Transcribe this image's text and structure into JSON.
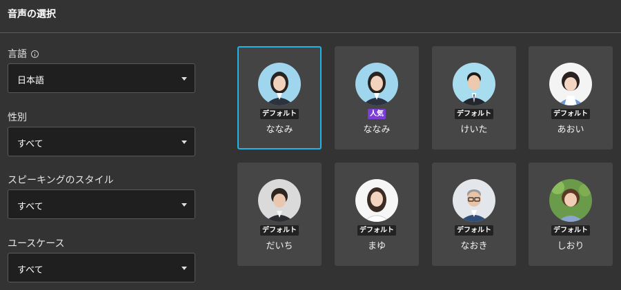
{
  "dialog": {
    "title": "音声の選択"
  },
  "filters": {
    "language": {
      "label": "言語",
      "value": "日本語"
    },
    "gender": {
      "label": "性別",
      "value": "すべて"
    },
    "style": {
      "label": "スピーキングのスタイル",
      "value": "すべて"
    },
    "usecase": {
      "label": "ユースケース",
      "value": "すべて"
    }
  },
  "voices": [
    {
      "name": "ななみ",
      "badge": "デフォルト",
      "selected": true
    },
    {
      "name": "ななみ",
      "badge": "人気"
    },
    {
      "name": "けいた",
      "badge": "デフォルト"
    },
    {
      "name": "あおい",
      "badge": "デフォルト"
    },
    {
      "name": "だいち",
      "badge": "デフォルト"
    },
    {
      "name": "まゆ",
      "badge": "デフォルト"
    },
    {
      "name": "なおき",
      "badge": "デフォルト"
    },
    {
      "name": "しおり",
      "badge": "デフォルト"
    }
  ],
  "colors": {
    "selection_border": "#1eb6e6",
    "popular_badge": "#7b3fd6"
  }
}
